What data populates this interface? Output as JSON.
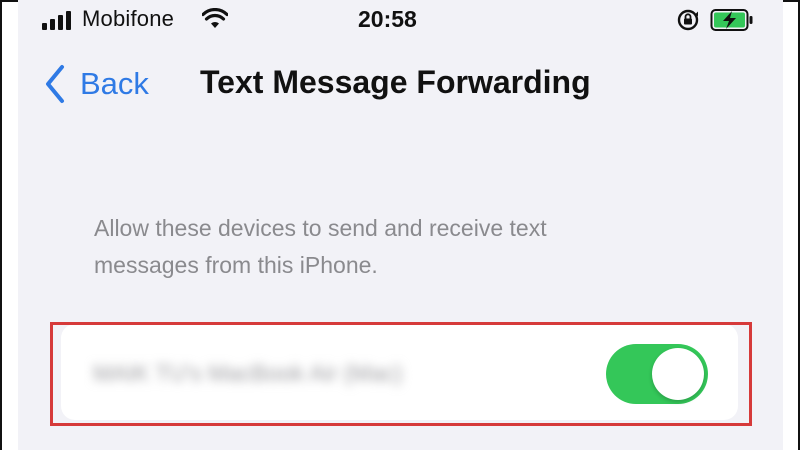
{
  "status_bar": {
    "carrier": "Mobifone",
    "time": "20:58",
    "icons": [
      "signal-icon",
      "wifi-icon",
      "rotation-lock-icon",
      "battery-charging-icon"
    ]
  },
  "nav": {
    "back_label": "Back",
    "title": "Text Message Forwarding"
  },
  "description": {
    "line1": "Allow these devices to send and receive text",
    "line2": "messages from this iPhone."
  },
  "device": {
    "name": "MAIK TU's MacBook Air (Mac)",
    "toggle_on": true
  },
  "colors": {
    "accent": "#2f7ae5",
    "toggle_on": "#34c759",
    "highlight": "#d63a3a",
    "background": "#f2f2f7",
    "battery": "#34c759"
  }
}
